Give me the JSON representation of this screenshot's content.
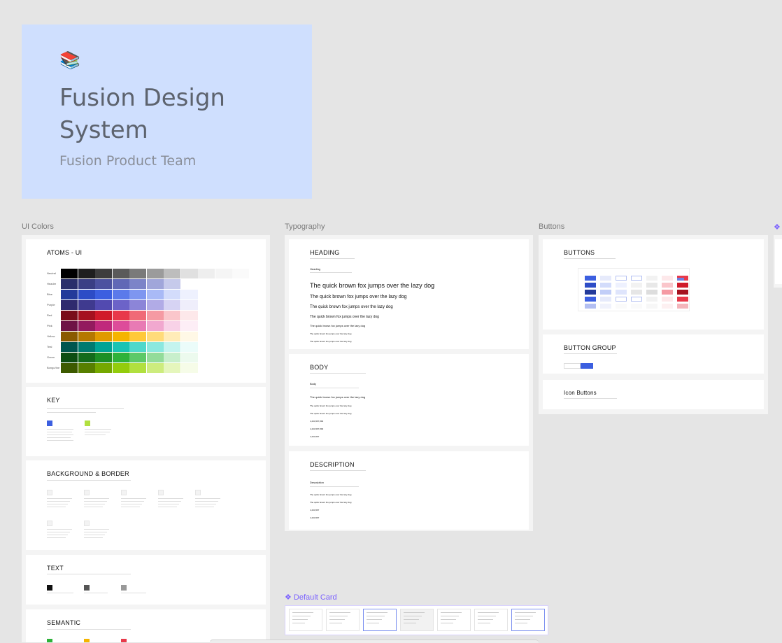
{
  "cover": {
    "emoji": "📚",
    "title": "Fusion Design System",
    "team": "Fusion Product Team"
  },
  "frames": {
    "ui_colors": "UI Colors",
    "typography": "Typography",
    "buttons": "Buttons",
    "default_card": "❖ Default Card"
  },
  "colors_sections": {
    "atoms": "ATOMS - UI",
    "key": "KEY",
    "background": "BACKGROUND & BORDER",
    "text": "TEXT",
    "semantic": "SEMANTIC"
  },
  "color_rows": [
    "Neutral",
    "Header",
    "Blue",
    "Purple",
    "Red",
    "Pink",
    "Yellow",
    "Teal",
    "Green",
    "Bongo/Ine"
  ],
  "palette": {
    "Neutral": [
      "#000000",
      "#1f1f1f",
      "#3d3d3d",
      "#5a5a5a",
      "#7a7a7a",
      "#9b9b9b",
      "#bdbdbd",
      "#e0e0e0",
      "#eeeeee",
      "#f5f5f5",
      "#fafafa"
    ],
    "Header": [
      "#2a2f6b",
      "#3a3f85",
      "#4c52a0",
      "#6068b6",
      "#7c84c8",
      "#a0a6da",
      "#c6caeb"
    ],
    "Blue": [
      "#233a9a",
      "#2d4cc6",
      "#3c5fe0",
      "#5b7aea",
      "#7e96f0",
      "#a9baf6",
      "#d3dcfb",
      "#eef1fe"
    ],
    "Purple": [
      "#2f2a6e",
      "#3f3a8f",
      "#524ab0",
      "#6c63c8",
      "#8c85d8",
      "#b1abe6",
      "#d6d3f3",
      "#efeefb"
    ],
    "Red": [
      "#7a0d1a",
      "#a5111f",
      "#d01a2a",
      "#e8394a",
      "#f06a77",
      "#f59aa3",
      "#fac6cb",
      "#fde8ea"
    ],
    "Pink": [
      "#6e1245",
      "#931a5e",
      "#c0287c",
      "#dd4c9a",
      "#e87ab4",
      "#f1a8cf",
      "#f8d2e7",
      "#fdeef6"
    ],
    "Yellow": [
      "#8a5a00",
      "#b57800",
      "#e09a00",
      "#f5b400",
      "#ffc93a",
      "#ffdb7a",
      "#ffecb8",
      "#fff8e6"
    ],
    "Teal": [
      "#00564f",
      "#007a70",
      "#00a395",
      "#19c3b3",
      "#4fd8cb",
      "#8be8df",
      "#c4f4ef",
      "#ebfcfa"
    ],
    "Green": [
      "#0c4d12",
      "#136b1b",
      "#1c8f26",
      "#2eb23a",
      "#5cc968",
      "#93dc9a",
      "#c8efcc",
      "#ecfaee"
    ],
    "Bongo/Ine": [
      "#3d5a00",
      "#577f00",
      "#75a800",
      "#93cc0c",
      "#b1e03f",
      "#cdec7e",
      "#e5f6bc",
      "#f6fce8"
    ]
  },
  "typography_sections": {
    "heading": "HEADING",
    "body": "BODY",
    "description": "DESCRIPTION"
  },
  "typo_sample": "The quick brown fox jumps over the lazy dog",
  "body_values": [
    "1,234,567,890",
    "1,234,567,890",
    "1,234,567"
  ],
  "buttons_sections": {
    "buttons": "BUTTONS",
    "group": "BUTTON GROUP",
    "icon": "Icon Buttons"
  },
  "accent": "#7b61ff",
  "cover_bg": "#cfdffe"
}
